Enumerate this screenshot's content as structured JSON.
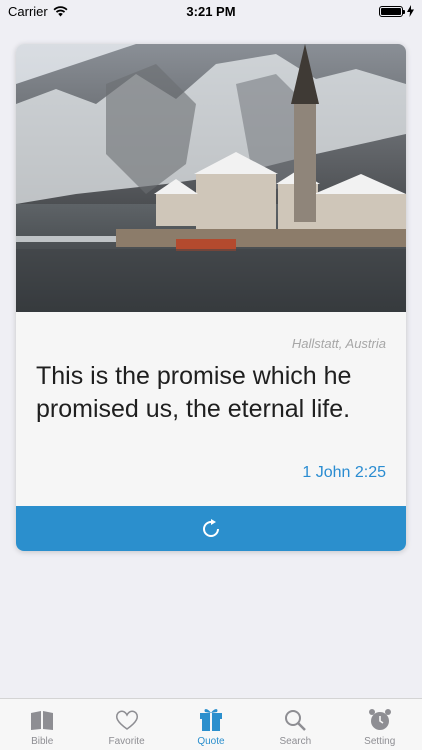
{
  "status_bar": {
    "carrier": "Carrier",
    "time": "3:21 PM"
  },
  "card": {
    "location": "Hallstatt, Austria",
    "quote": "This is the promise which he promised us, the eternal life.",
    "reference": "1 John 2:25"
  },
  "tabs": [
    {
      "label": "Bible",
      "icon": "book-icon"
    },
    {
      "label": "Favorite",
      "icon": "heart-icon"
    },
    {
      "label": "Quote",
      "icon": "gift-icon",
      "active": true
    },
    {
      "label": "Search",
      "icon": "search-icon"
    },
    {
      "label": "Setting",
      "icon": "alarm-clock-icon"
    }
  ],
  "colors": {
    "accent": "#2b8fcd",
    "reference": "#2a8cd1",
    "inactive_tab": "#8e8e93"
  }
}
